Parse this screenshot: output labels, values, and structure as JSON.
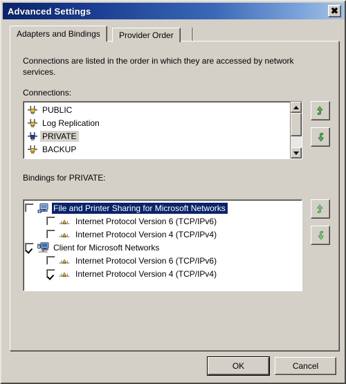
{
  "window": {
    "title": "Advanced Settings",
    "close_label": "✕"
  },
  "tabs": [
    {
      "label": "Adapters and Bindings",
      "active": true
    },
    {
      "label": "Provider Order",
      "active": false
    }
  ],
  "description": "Connections are listed in the order in which they are accessed by network services.",
  "connections_section": {
    "label": "Connections:",
    "items": [
      {
        "name": "PUBLIC",
        "icon": "network-adapter-icon",
        "selected": false
      },
      {
        "name": "Log Replication",
        "icon": "network-adapter-icon",
        "selected": false
      },
      {
        "name": "PRIVATE",
        "icon": "network-adapter-icon-active",
        "selected": true
      },
      {
        "name": "BACKUP",
        "icon": "network-adapter-icon",
        "selected": false
      }
    ],
    "move_up_icon": "arrow-up-icon",
    "move_down_icon": "arrow-down-icon",
    "scrollbar": {
      "up_icon": "scroll-up-arrow-icon",
      "down_icon": "scroll-down-arrow-icon"
    }
  },
  "bindings_section": {
    "label": "Bindings for PRIVATE:",
    "items": [
      {
        "name": "File and Printer Sharing for Microsoft Networks",
        "checked": false,
        "selected": true,
        "child": false,
        "icon": "file-printer-sharing-icon"
      },
      {
        "name": "Internet Protocol Version 6 (TCP/IPv6)",
        "checked": false,
        "selected": false,
        "child": true,
        "icon": "protocol-icon"
      },
      {
        "name": "Internet Protocol Version 4 (TCP/IPv4)",
        "checked": false,
        "selected": false,
        "child": true,
        "icon": "protocol-icon"
      },
      {
        "name": "Client for Microsoft Networks",
        "checked": true,
        "selected": false,
        "child": false,
        "icon": "client-networks-icon"
      },
      {
        "name": "Internet Protocol Version 6 (TCP/IPv6)",
        "checked": false,
        "selected": false,
        "child": true,
        "icon": "protocol-icon"
      },
      {
        "name": "Internet Protocol Version 4 (TCP/IPv4)",
        "checked": true,
        "selected": false,
        "child": true,
        "icon": "protocol-icon"
      }
    ],
    "move_up_icon": "arrow-up-icon",
    "move_down_icon": "arrow-down-icon"
  },
  "footer": {
    "ok_label": "OK",
    "cancel_label": "Cancel"
  },
  "colors": {
    "dialog_face": "#d4d0c8",
    "title_gradient_start": "#0a246a",
    "title_gradient_end": "#a6c3e8",
    "selection_blue": "#0a246a",
    "selection_inactive": "#d8d4cc",
    "arrow_green": "#5cb35c"
  }
}
